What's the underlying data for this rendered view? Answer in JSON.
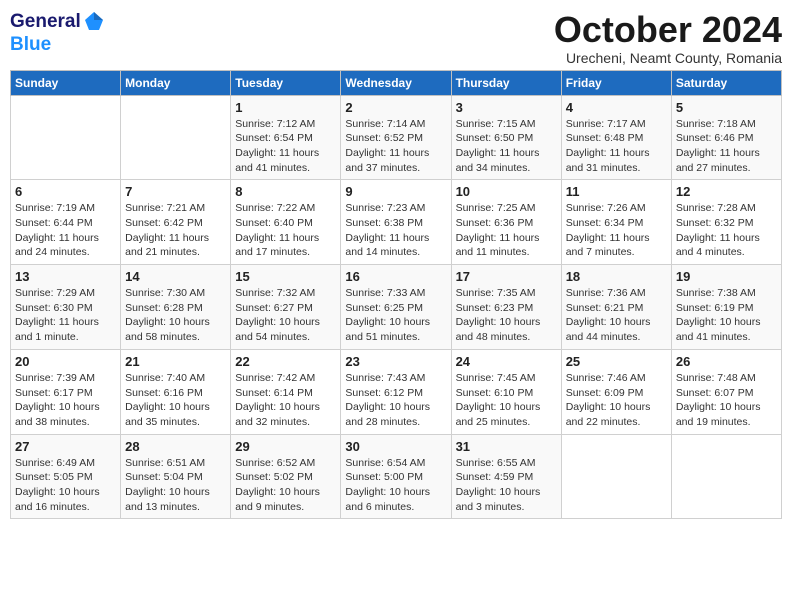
{
  "header": {
    "logo_general": "General",
    "logo_blue": "Blue",
    "month_title": "October 2024",
    "subtitle": "Urecheni, Neamt County, Romania"
  },
  "weekdays": [
    "Sunday",
    "Monday",
    "Tuesday",
    "Wednesday",
    "Thursday",
    "Friday",
    "Saturday"
  ],
  "weeks": [
    [
      {
        "day": "",
        "sunrise": "",
        "sunset": "",
        "daylight": ""
      },
      {
        "day": "",
        "sunrise": "",
        "sunset": "",
        "daylight": ""
      },
      {
        "day": "1",
        "sunrise": "Sunrise: 7:12 AM",
        "sunset": "Sunset: 6:54 PM",
        "daylight": "Daylight: 11 hours and 41 minutes."
      },
      {
        "day": "2",
        "sunrise": "Sunrise: 7:14 AM",
        "sunset": "Sunset: 6:52 PM",
        "daylight": "Daylight: 11 hours and 37 minutes."
      },
      {
        "day": "3",
        "sunrise": "Sunrise: 7:15 AM",
        "sunset": "Sunset: 6:50 PM",
        "daylight": "Daylight: 11 hours and 34 minutes."
      },
      {
        "day": "4",
        "sunrise": "Sunrise: 7:17 AM",
        "sunset": "Sunset: 6:48 PM",
        "daylight": "Daylight: 11 hours and 31 minutes."
      },
      {
        "day": "5",
        "sunrise": "Sunrise: 7:18 AM",
        "sunset": "Sunset: 6:46 PM",
        "daylight": "Daylight: 11 hours and 27 minutes."
      }
    ],
    [
      {
        "day": "6",
        "sunrise": "Sunrise: 7:19 AM",
        "sunset": "Sunset: 6:44 PM",
        "daylight": "Daylight: 11 hours and 24 minutes."
      },
      {
        "day": "7",
        "sunrise": "Sunrise: 7:21 AM",
        "sunset": "Sunset: 6:42 PM",
        "daylight": "Daylight: 11 hours and 21 minutes."
      },
      {
        "day": "8",
        "sunrise": "Sunrise: 7:22 AM",
        "sunset": "Sunset: 6:40 PM",
        "daylight": "Daylight: 11 hours and 17 minutes."
      },
      {
        "day": "9",
        "sunrise": "Sunrise: 7:23 AM",
        "sunset": "Sunset: 6:38 PM",
        "daylight": "Daylight: 11 hours and 14 minutes."
      },
      {
        "day": "10",
        "sunrise": "Sunrise: 7:25 AM",
        "sunset": "Sunset: 6:36 PM",
        "daylight": "Daylight: 11 hours and 11 minutes."
      },
      {
        "day": "11",
        "sunrise": "Sunrise: 7:26 AM",
        "sunset": "Sunset: 6:34 PM",
        "daylight": "Daylight: 11 hours and 7 minutes."
      },
      {
        "day": "12",
        "sunrise": "Sunrise: 7:28 AM",
        "sunset": "Sunset: 6:32 PM",
        "daylight": "Daylight: 11 hours and 4 minutes."
      }
    ],
    [
      {
        "day": "13",
        "sunrise": "Sunrise: 7:29 AM",
        "sunset": "Sunset: 6:30 PM",
        "daylight": "Daylight: 11 hours and 1 minute."
      },
      {
        "day": "14",
        "sunrise": "Sunrise: 7:30 AM",
        "sunset": "Sunset: 6:28 PM",
        "daylight": "Daylight: 10 hours and 58 minutes."
      },
      {
        "day": "15",
        "sunrise": "Sunrise: 7:32 AM",
        "sunset": "Sunset: 6:27 PM",
        "daylight": "Daylight: 10 hours and 54 minutes."
      },
      {
        "day": "16",
        "sunrise": "Sunrise: 7:33 AM",
        "sunset": "Sunset: 6:25 PM",
        "daylight": "Daylight: 10 hours and 51 minutes."
      },
      {
        "day": "17",
        "sunrise": "Sunrise: 7:35 AM",
        "sunset": "Sunset: 6:23 PM",
        "daylight": "Daylight: 10 hours and 48 minutes."
      },
      {
        "day": "18",
        "sunrise": "Sunrise: 7:36 AM",
        "sunset": "Sunset: 6:21 PM",
        "daylight": "Daylight: 10 hours and 44 minutes."
      },
      {
        "day": "19",
        "sunrise": "Sunrise: 7:38 AM",
        "sunset": "Sunset: 6:19 PM",
        "daylight": "Daylight: 10 hours and 41 minutes."
      }
    ],
    [
      {
        "day": "20",
        "sunrise": "Sunrise: 7:39 AM",
        "sunset": "Sunset: 6:17 PM",
        "daylight": "Daylight: 10 hours and 38 minutes."
      },
      {
        "day": "21",
        "sunrise": "Sunrise: 7:40 AM",
        "sunset": "Sunset: 6:16 PM",
        "daylight": "Daylight: 10 hours and 35 minutes."
      },
      {
        "day": "22",
        "sunrise": "Sunrise: 7:42 AM",
        "sunset": "Sunset: 6:14 PM",
        "daylight": "Daylight: 10 hours and 32 minutes."
      },
      {
        "day": "23",
        "sunrise": "Sunrise: 7:43 AM",
        "sunset": "Sunset: 6:12 PM",
        "daylight": "Daylight: 10 hours and 28 minutes."
      },
      {
        "day": "24",
        "sunrise": "Sunrise: 7:45 AM",
        "sunset": "Sunset: 6:10 PM",
        "daylight": "Daylight: 10 hours and 25 minutes."
      },
      {
        "day": "25",
        "sunrise": "Sunrise: 7:46 AM",
        "sunset": "Sunset: 6:09 PM",
        "daylight": "Daylight: 10 hours and 22 minutes."
      },
      {
        "day": "26",
        "sunrise": "Sunrise: 7:48 AM",
        "sunset": "Sunset: 6:07 PM",
        "daylight": "Daylight: 10 hours and 19 minutes."
      }
    ],
    [
      {
        "day": "27",
        "sunrise": "Sunrise: 6:49 AM",
        "sunset": "Sunset: 5:05 PM",
        "daylight": "Daylight: 10 hours and 16 minutes."
      },
      {
        "day": "28",
        "sunrise": "Sunrise: 6:51 AM",
        "sunset": "Sunset: 5:04 PM",
        "daylight": "Daylight: 10 hours and 13 minutes."
      },
      {
        "day": "29",
        "sunrise": "Sunrise: 6:52 AM",
        "sunset": "Sunset: 5:02 PM",
        "daylight": "Daylight: 10 hours and 9 minutes."
      },
      {
        "day": "30",
        "sunrise": "Sunrise: 6:54 AM",
        "sunset": "Sunset: 5:00 PM",
        "daylight": "Daylight: 10 hours and 6 minutes."
      },
      {
        "day": "31",
        "sunrise": "Sunrise: 6:55 AM",
        "sunset": "Sunset: 4:59 PM",
        "daylight": "Daylight: 10 hours and 3 minutes."
      },
      {
        "day": "",
        "sunrise": "",
        "sunset": "",
        "daylight": ""
      },
      {
        "day": "",
        "sunrise": "",
        "sunset": "",
        "daylight": ""
      }
    ]
  ]
}
